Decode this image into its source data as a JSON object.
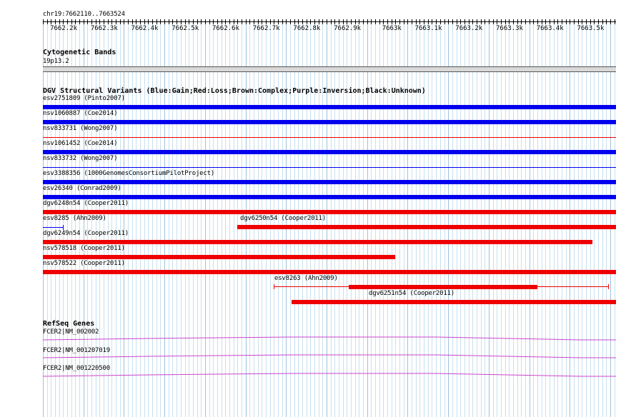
{
  "position": {
    "label": "chr19:7662110..7663524",
    "ticks": [
      {
        "label": "7662.2k",
        "coord": 7662200
      },
      {
        "label": "7662.3k",
        "coord": 7662300
      },
      {
        "label": "7662.4k",
        "coord": 7662400
      },
      {
        "label": "7662.5k",
        "coord": 7662500
      },
      {
        "label": "7662.6k",
        "coord": 7662600
      },
      {
        "label": "7662.7k",
        "coord": 7662700
      },
      {
        "label": "7662.8k",
        "coord": 7662800
      },
      {
        "label": "7662.9k",
        "coord": 7662900
      },
      {
        "label": "7663k",
        "coord": 7663000
      },
      {
        "label": "7663.1k",
        "coord": 7663100
      },
      {
        "label": "7663.2k",
        "coord": 7663200
      },
      {
        "label": "7663.3k",
        "coord": 7663300
      },
      {
        "label": "7663.4k",
        "coord": 7663400
      },
      {
        "label": "7663.5k",
        "coord": 7663500
      }
    ]
  },
  "cytoband": {
    "title": "Cytogenetic Bands",
    "band": "19p13.2",
    "color": "#d9d9d9"
  },
  "dgv": {
    "title": "DGV Structural Variants (Blue:Gain;Red:Loss;Brown:Complex;Purple:Inversion;Black:Unknown)",
    "colors": {
      "gain": "#0000ee",
      "loss": "#ee0000"
    },
    "variants": [
      {
        "label": "esv2751809 (Pinto2007)",
        "type": "gain",
        "style": "bar",
        "start": 7662110,
        "end": 7663524
      },
      {
        "label": "nsv1060887 (Coe2014)",
        "type": "gain",
        "style": "bar",
        "start": 7662110,
        "end": 7663524
      },
      {
        "label": "nsv833731 (Wong2007)",
        "type": "loss",
        "style": "line",
        "start": 7662110,
        "end": 7663524
      },
      {
        "label": "nsv1061452 (Coe2014)",
        "type": "gain",
        "style": "bar",
        "start": 7662110,
        "end": 7663524
      },
      {
        "label": "nsv833732 (Wong2007)",
        "type": "gain",
        "style": "line",
        "start": 7662110,
        "end": 7663524
      },
      {
        "label": "esv3388356 (1000GenomesConsortiumPilotProject)",
        "type": "gain",
        "style": "bar",
        "start": 7662110,
        "end": 7663524
      },
      {
        "label": "esv26340 (Conrad2009)",
        "type": "gain",
        "style": "bar",
        "start": 7662110,
        "end": 7663524
      },
      {
        "label": "dgv6248n54 (Cooper2011)",
        "type": "loss",
        "style": "bar",
        "start": 7662110,
        "end": 7663524
      },
      {
        "label": "esv8285 (Ahn2009)",
        "type": "gain",
        "style": "line",
        "start": 7662110,
        "end": 7662160
      },
      {
        "label": "dgv6250n54 (Cooper2011)",
        "type": "loss",
        "style": "bar",
        "start": 7662590,
        "end": 7663524
      },
      {
        "label": "dgv6249n54 (Cooper2011)",
        "type": "loss",
        "style": "bar",
        "start": 7662110,
        "end": 7663465
      },
      {
        "label": "nsv578518 (Cooper2011)",
        "type": "loss",
        "style": "bar",
        "start": 7662110,
        "end": 7662980
      },
      {
        "label": "nsv578522 (Cooper2011)",
        "type": "loss",
        "style": "bar",
        "start": 7662110,
        "end": 7663524
      },
      {
        "label": "esv8263 (Ahn2009)",
        "type": "loss",
        "style": "split",
        "start": 7662680,
        "end": 7663505,
        "thick_start": 7662865,
        "thick_end": 7663330
      },
      {
        "label": "dgv6251n54 (Cooper2011)",
        "type": "loss",
        "style": "bar",
        "start": 7662723,
        "end": 7663524
      }
    ]
  },
  "refseq": {
    "title": "RefSeq Genes",
    "color": "#cc44cc",
    "genes": [
      {
        "label": "FCER2|NM_002002"
      },
      {
        "label": "FCER2|NM_001207019"
      },
      {
        "label": "FCER2|NM_001220500"
      }
    ]
  }
}
